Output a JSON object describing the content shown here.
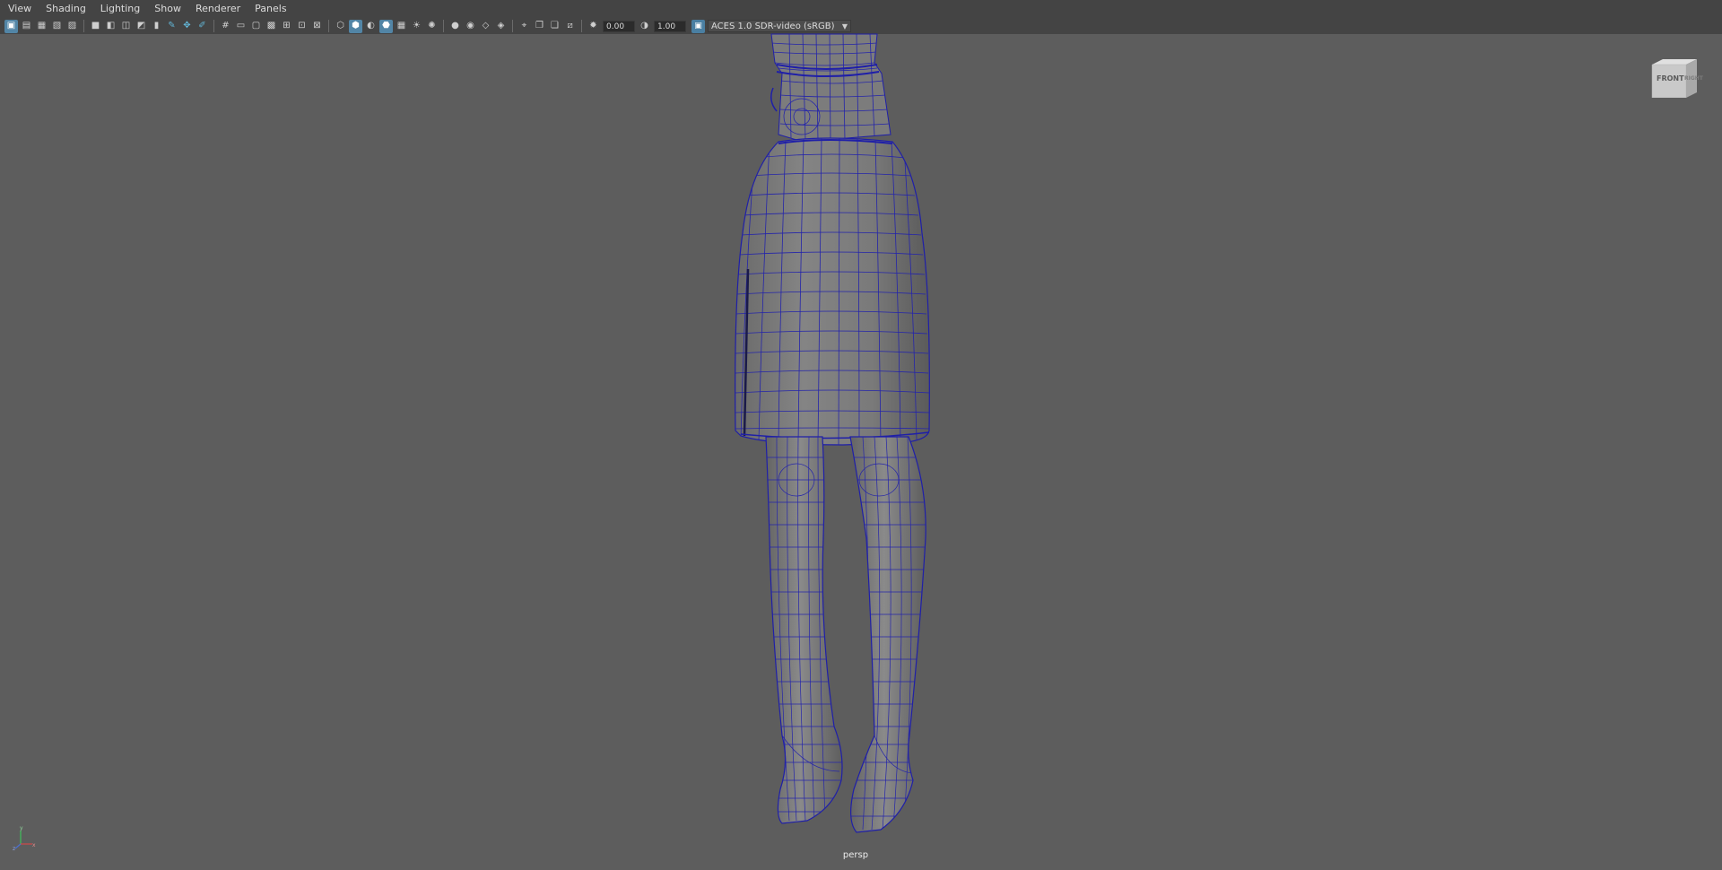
{
  "menu": [
    "View",
    "Shading",
    "Lighting",
    "Show",
    "Renderer",
    "Panels"
  ],
  "toolbar": {
    "exposure_value": "0.00",
    "gamma_value": "1.00",
    "color_space": "ACES 1.0 SDR-video (sRGB)"
  },
  "viewcube": {
    "front_label": "FRONT",
    "right_label": "RIGHT"
  },
  "viewport": {
    "camera_label": "persp"
  },
  "axis": {
    "y_label": "y",
    "x_label": "x",
    "z_label": "z"
  },
  "colors": {
    "wireframe": "#1f1fa8",
    "viewport_bg": "#5d5d5d",
    "ui_bg": "#444444",
    "active_tool": "#5285a6"
  }
}
